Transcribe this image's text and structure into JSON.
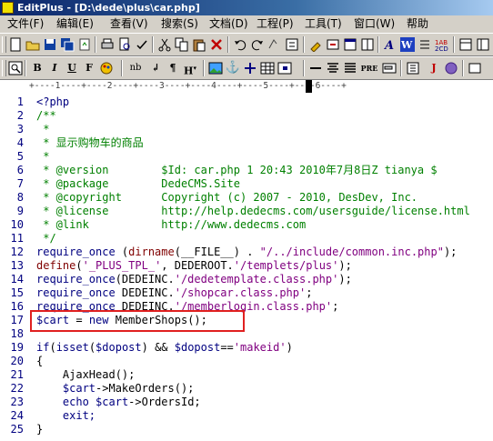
{
  "window": {
    "title": "EditPlus - [D:\\dede\\plus\\car.php]"
  },
  "menu": [
    "文件(F)",
    "编辑(E)",
    "查看(V)",
    "搜索(S)",
    "文档(D)",
    "工程(P)",
    "工具(T)",
    "窗口(W)",
    "帮助"
  ],
  "ruler": "+----1----+----2----+----3----+----4----+----5----+----6----+",
  "code_lines": [
    {
      "n": "1",
      "text": "<?php",
      "kind": "kw"
    },
    {
      "n": "2",
      "text": "/**",
      "kind": "cm"
    },
    {
      "n": "3",
      "text": " *",
      "kind": "cm"
    },
    {
      "n": "4",
      "text": " * 显示购物车的商品",
      "kind": "cm"
    },
    {
      "n": "5",
      "text": " *",
      "kind": "cm"
    },
    {
      "n": "6",
      "text": " * @version        $Id: car.php 1 20:43 2010年7月8日Z tianya $",
      "kind": "cm"
    },
    {
      "n": "7",
      "text": " * @package        DedeCMS.Site",
      "kind": "cm"
    },
    {
      "n": "8",
      "text": " * @copyright      Copyright (c) 2007 - 2010, DesDev, Inc.",
      "kind": "cm"
    },
    {
      "n": "9",
      "text": " * @license        http://help.dedecms.com/usersguide/license.html",
      "kind": "cm"
    },
    {
      "n": "10",
      "text": " * @link           http://www.dedecms.com",
      "kind": "cm"
    },
    {
      "n": "11",
      "text": " */",
      "kind": "cm"
    },
    {
      "n": "12",
      "text": "require_once (dirname(__FILE__) . \"/../include/common.inc.php\");",
      "kind": "mixed"
    },
    {
      "n": "13",
      "text": "define('_PLUS_TPL_', DEDEROOT.'/templets/plus');",
      "kind": "mixed"
    },
    {
      "n": "14",
      "text": "require_once(DEDEINC.'/dedetemplate.class.php');",
      "kind": "mixed"
    },
    {
      "n": "15",
      "text": "require_once DEDEINC.'/shopcar.class.php';",
      "kind": "mixed"
    },
    {
      "n": "16",
      "text": "require_once DEDEINC.'/memberlogin.class.php';",
      "kind": "mixed"
    },
    {
      "n": "17",
      "text": "$cart = new MemberShops();",
      "kind": "mixed"
    },
    {
      "n": "18",
      "text": "",
      "kind": "df"
    },
    {
      "n": "19",
      "text": "if(isset($dopost) && $dopost=='makeid')",
      "kind": "mixed"
    },
    {
      "n": "20",
      "text": "{",
      "kind": "df"
    },
    {
      "n": "21",
      "text": "    AjaxHead();",
      "kind": "df"
    },
    {
      "n": "22",
      "text": "    $cart->MakeOrders();",
      "kind": "mixed"
    },
    {
      "n": "23",
      "text": "    echo $cart->OrdersId;",
      "kind": "mixed"
    },
    {
      "n": "24",
      "text": "    exit;",
      "kind": "kw"
    },
    {
      "n": "25",
      "text": "}",
      "kind": "df"
    }
  ],
  "tokens": {
    "l12": [
      "require_once",
      " (",
      "dirname",
      "(__FILE__) . ",
      "\"/../include/common.inc.php\"",
      ");"
    ],
    "l13": [
      "define",
      "(",
      "'_PLUS_TPL_'",
      ", DEDEROOT.",
      "'/templets/plus'",
      ");"
    ],
    "l14": [
      "require_once",
      "(DEDEINC.",
      "'/dedetemplate.class.php'",
      ");"
    ],
    "l15": [
      "require_once",
      " DEDEINC.",
      "'/shopcar.class.php'",
      ";"
    ],
    "l16": [
      "require_once",
      " DEDEINC.",
      "'/memberlogin.class.php'",
      ";"
    ],
    "l17": [
      "$cart",
      " = ",
      "new",
      " MemberShops();"
    ],
    "l19": [
      "if",
      "(",
      "isset",
      "(",
      "$dopost",
      ") && ",
      "$dopost",
      "==",
      "'makeid'",
      ")"
    ],
    "l22": [
      "    ",
      "$cart",
      "->MakeOrders();"
    ],
    "l23": [
      "    ",
      "echo",
      " ",
      "$cart",
      "->OrdersId;"
    ]
  },
  "colors": {
    "comment": "#008000",
    "keyword": "#000080",
    "string": "#800080",
    "function": "#800000",
    "highlight_box": "#e02020"
  },
  "highlight": {
    "line": "17"
  }
}
